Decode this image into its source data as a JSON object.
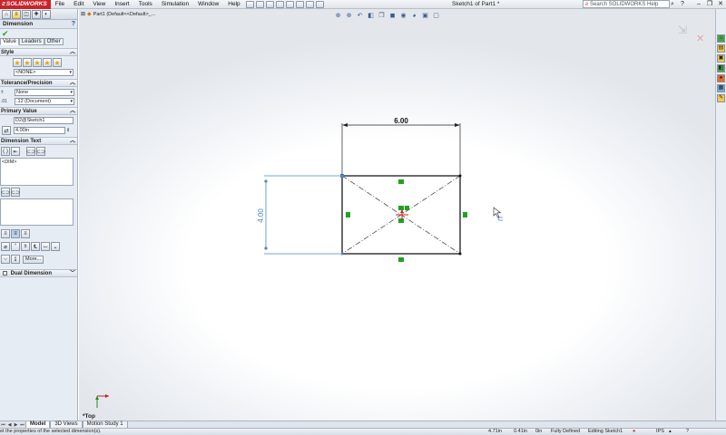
{
  "app": {
    "logo": "SOLIDWORKS",
    "doc_title": "Sketch1 of Part1 *"
  },
  "menu": [
    "File",
    "Edit",
    "View",
    "Insert",
    "Tools",
    "Simulation",
    "Window",
    "Help"
  ],
  "search": {
    "placeholder": "Search SOLIDWORKS Help"
  },
  "panel": {
    "title": "Dimension",
    "help": "?",
    "subtabs": [
      "Value",
      "Leaders",
      "Other"
    ],
    "style": {
      "header": "Style",
      "select": "<NONE>"
    },
    "tolerance": {
      "header": "Tolerance/Precision",
      "tol_select": "None",
      "precision_select": ".12 (Document)"
    },
    "primary_value": {
      "header": "Primary Value",
      "name": "D2@Sketch1",
      "value": "4.00in"
    },
    "dimension_text": {
      "header": "Dimension Text",
      "text": "<DIM>",
      "more": "More..."
    },
    "dual_dimension": {
      "header": "Dual Dimension"
    }
  },
  "viewport": {
    "feature_tree": "Part1  (Default<<Default>_...",
    "view_label": "*Top",
    "dim_horizontal": "6.00",
    "dim_vertical": "4.00"
  },
  "colors": {
    "dim_selected": "#4a86c8",
    "relation": "#1fa31f",
    "origin": "#d02020"
  },
  "bottom_tabs": [
    "Model",
    "3D Views",
    "Motion Study 1"
  ],
  "status": {
    "message": "et the properties of the selected dimension(s).",
    "x": "4.71in",
    "y": "0.41in",
    "z": "0in",
    "state": "Fully Defined",
    "mode": "Editing Sketch1",
    "units": "IPS"
  }
}
